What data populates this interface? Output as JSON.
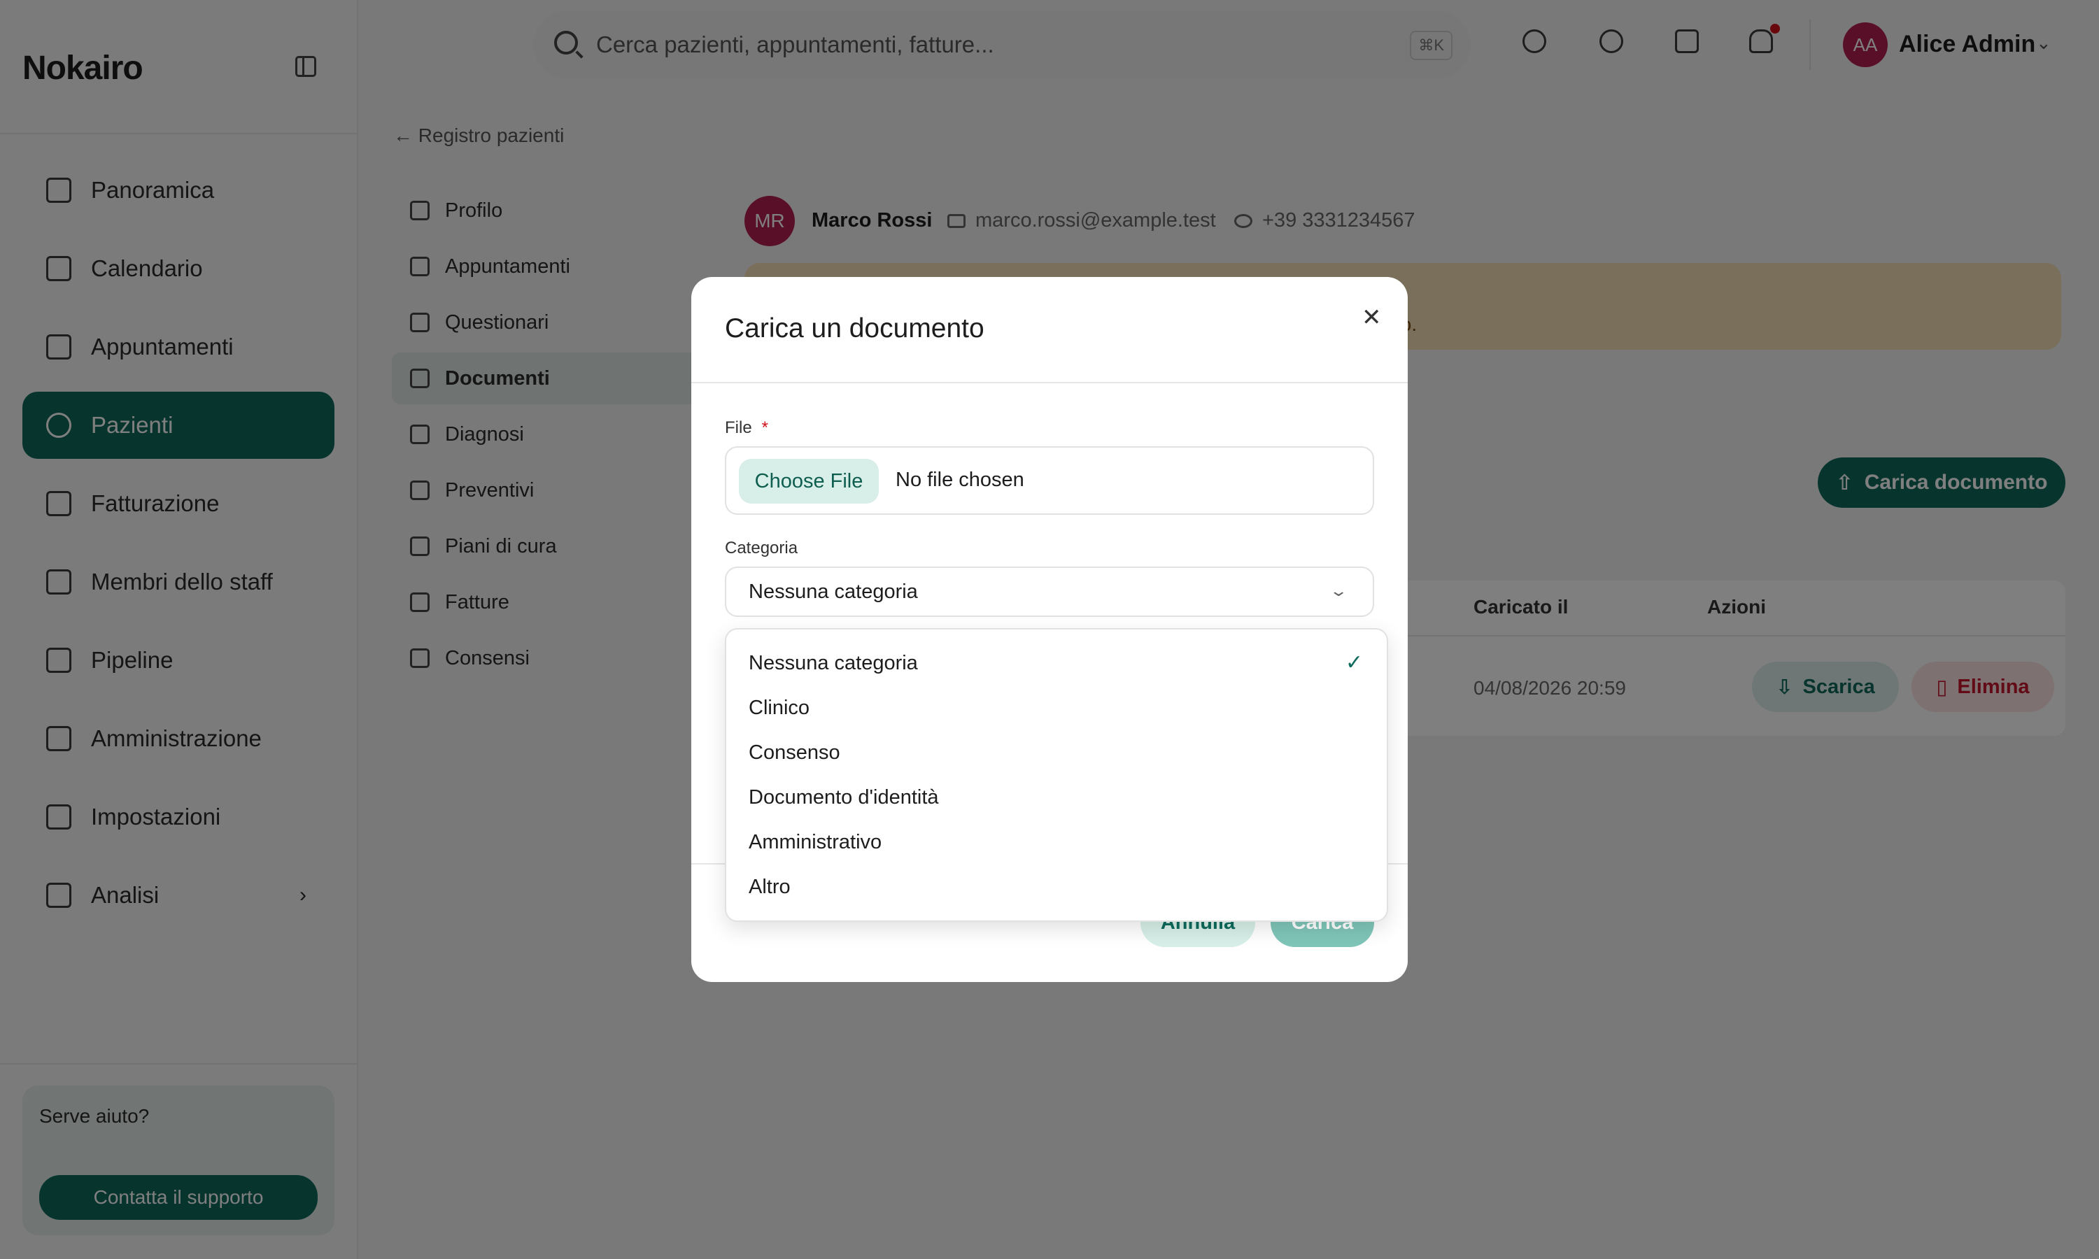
{
  "app": {
    "brand": "Nokairo"
  },
  "sidebar": {
    "items": [
      {
        "label": "Panoramica"
      },
      {
        "label": "Calendario"
      },
      {
        "label": "Appuntamenti"
      },
      {
        "label": "Pazienti"
      },
      {
        "label": "Fatturazione"
      },
      {
        "label": "Membri dello staff"
      },
      {
        "label": "Pipeline"
      },
      {
        "label": "Amministrazione"
      },
      {
        "label": "Impostazioni"
      },
      {
        "label": "Analisi"
      }
    ],
    "active": "Pazienti",
    "help": {
      "title": "Serve aiuto?",
      "button": "Contatta il supporto"
    }
  },
  "topbar": {
    "search_placeholder": "Cerca pazienti, appuntamenti, fatture...",
    "shortcut": "⌘K",
    "user": {
      "initials": "AA",
      "name": "Alice Admin"
    }
  },
  "content": {
    "back_link": "← Registro pazienti",
    "subnav": [
      {
        "label": "Profilo"
      },
      {
        "label": "Appuntamenti"
      },
      {
        "label": "Questionari"
      },
      {
        "label": "Documenti"
      },
      {
        "label": "Diagnosi"
      },
      {
        "label": "Preventivi"
      },
      {
        "label": "Piani di cura"
      },
      {
        "label": "Fatture"
      },
      {
        "label": "Consensi"
      }
    ],
    "active_subnav": "Documenti",
    "patient": {
      "initials": "MR",
      "name": "Marco Rossi",
      "email": "marco.rossi@example.test",
      "phone": "+39 3331234567"
    },
    "banner_text": "to.",
    "upload_button": "Carica documento",
    "table": {
      "headers": [
        "Caricato il",
        "Azioni"
      ],
      "rows": [
        {
          "uploaded": "04/08/2026 20:59",
          "download": "Scarica",
          "delete": "Elimina"
        }
      ]
    }
  },
  "modal": {
    "title": "Carica un documento",
    "file_label": "File",
    "required_mark": "*",
    "choose_file": "Choose File",
    "no_file": "No file chosen",
    "category_label": "Categoria",
    "category_value": "Nessuna categoria",
    "cancel": "Annulla",
    "submit": "Carica",
    "options": [
      "Nessuna categoria",
      "Clinico",
      "Consenso",
      "Documento d'identità",
      "Amministrativo",
      "Altro"
    ]
  },
  "colors": {
    "primary": "#0e6b5c",
    "avatar": "#b51e52",
    "danger": "#c4142a"
  }
}
